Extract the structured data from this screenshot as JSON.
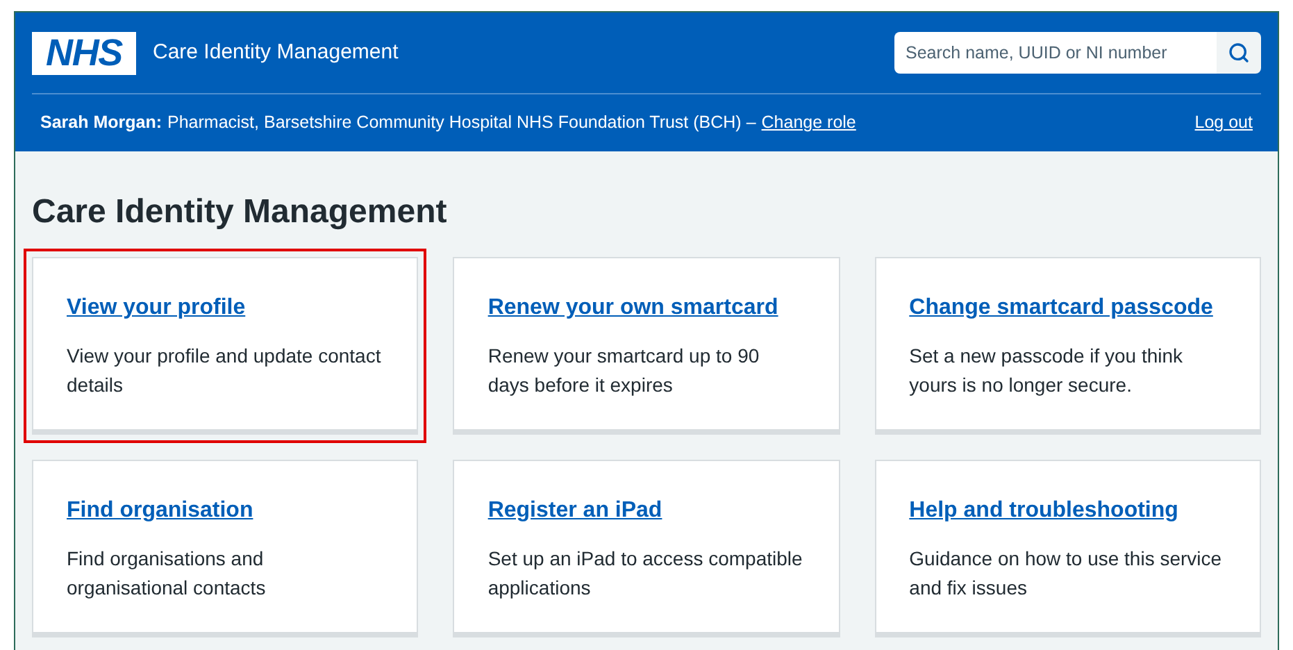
{
  "header": {
    "logo": "NHS",
    "service_name": "Care Identity Management",
    "search": {
      "placeholder": "Search name, UUID or NI number"
    }
  },
  "user_bar": {
    "name": "Sarah Morgan:",
    "role": "Pharmacist, Barsetshire Community Hospital NHS Foundation Trust (BCH) –",
    "change_link": "Change role",
    "logout": "Log out"
  },
  "page_title": "Care Identity Management",
  "cards": [
    {
      "title": "View your profile",
      "description": "View your profile and update contact details",
      "highlighted": true
    },
    {
      "title": "Renew your own smartcard",
      "description": "Renew your smartcard up to 90 days before it expires",
      "highlighted": false
    },
    {
      "title": "Change smartcard passcode",
      "description": "Set a new passcode if you think yours is no longer secure.",
      "highlighted": false
    },
    {
      "title": "Find organisation",
      "description": "Find organisations and organisational contacts",
      "highlighted": false
    },
    {
      "title": "Register an iPad",
      "description": "Set up an iPad to access compatible applications",
      "highlighted": false
    },
    {
      "title": "Help and troubleshooting",
      "description": "Guidance on how to use this service and fix issues",
      "highlighted": false
    }
  ]
}
